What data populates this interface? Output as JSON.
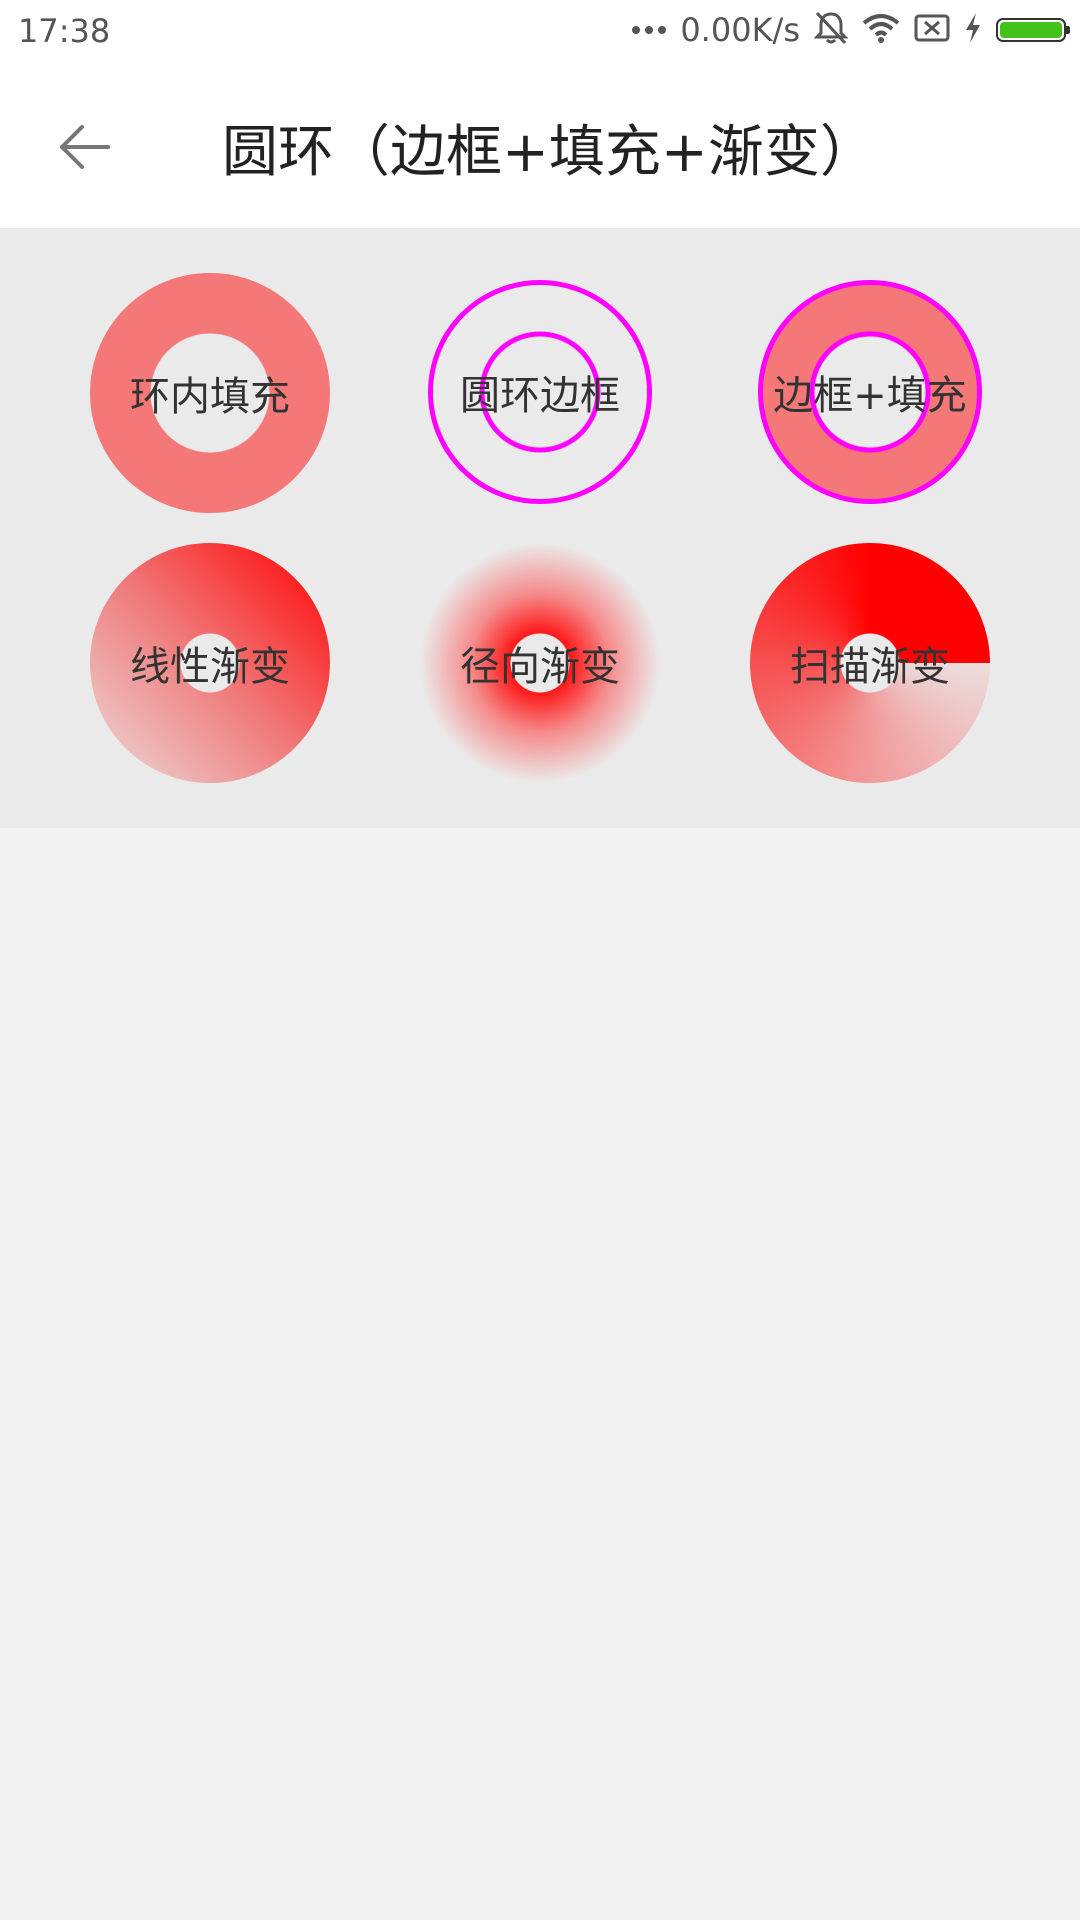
{
  "status_bar": {
    "time": "17:38",
    "net_speed": "0.00K/s",
    "icons": [
      "more-dots-icon",
      "mute-icon",
      "wifi-icon",
      "sim-missing-icon",
      "charging-icon",
      "battery-icon"
    ],
    "battery_color": "#44c21a"
  },
  "toolbar": {
    "back_icon": "arrow-left-icon",
    "title": "圆环（边框+填充+渐变）"
  },
  "rings": {
    "fill": "环内填充",
    "border": "圆环边框",
    "border_fill": "边框+填充",
    "linear": "线性渐变",
    "radial": "径向渐变",
    "sweep": "扫描渐变"
  },
  "colors": {
    "ring_fill": "#f47878",
    "ring_border": "#ff00ff",
    "gradient_red": "#ff0000",
    "panel_background": "#ebeaea",
    "page_background": "#f3f3f3"
  }
}
